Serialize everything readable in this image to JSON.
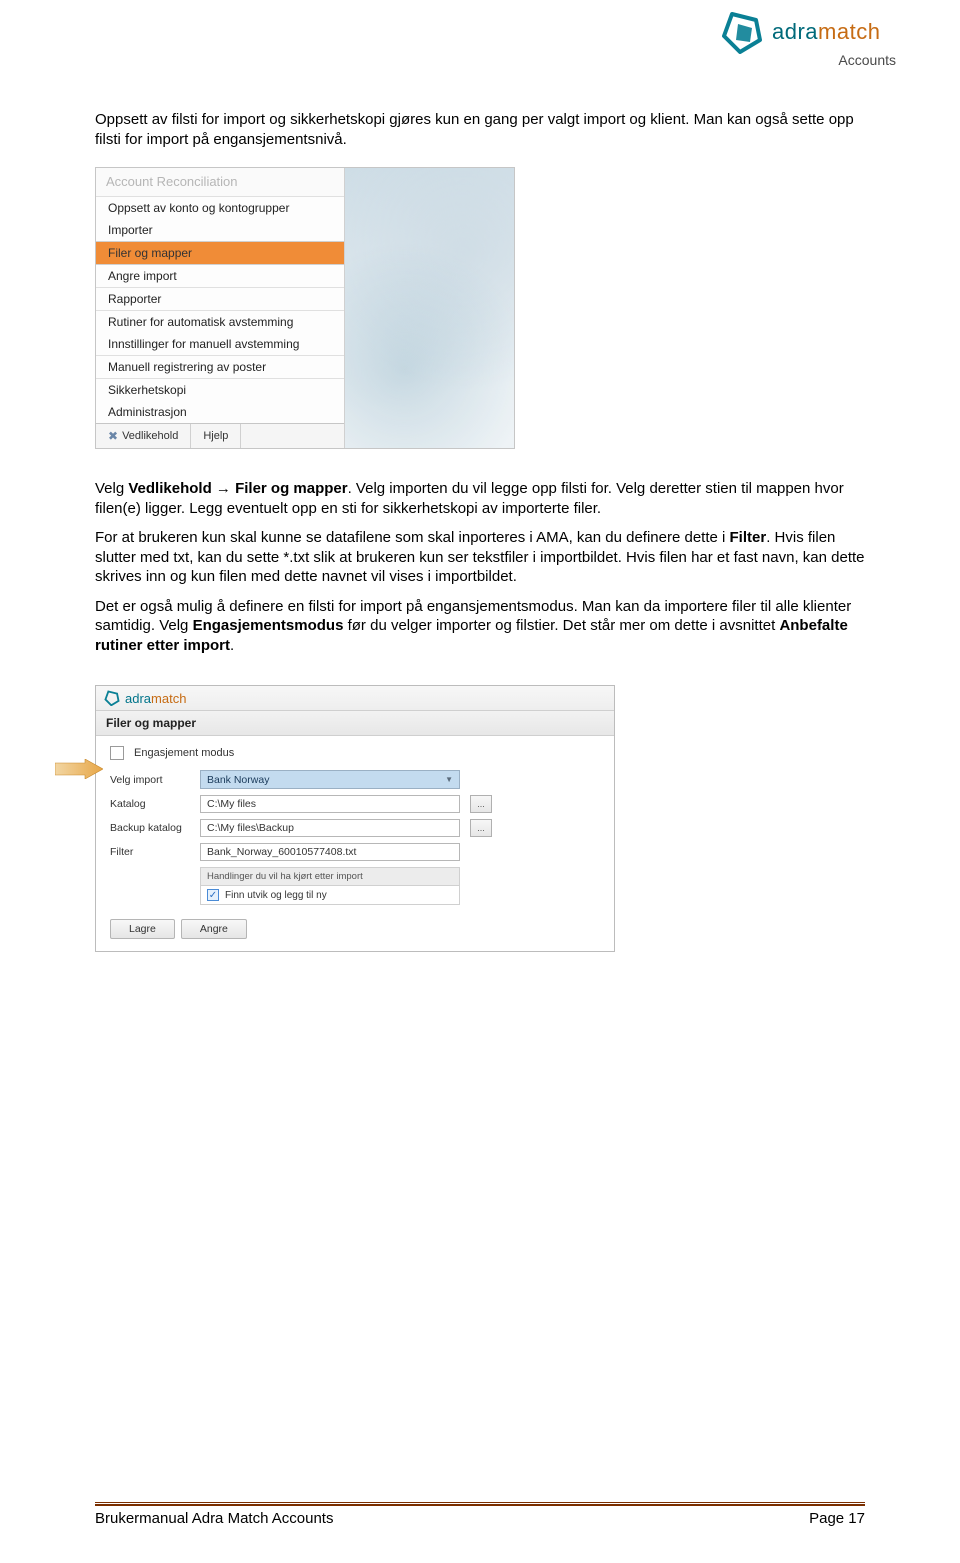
{
  "logo": {
    "brand": "adra",
    "brand2": "match",
    "sub": "Accounts"
  },
  "intro": {
    "p1a": "Oppsett av filsti for import og sikkerhetskopi gjøres kun en gang per valgt import og klient. ",
    "p1b": "Man kan også sette opp filsti for import på engansjementsnivå."
  },
  "sc1": {
    "header": "Account Reconciliation",
    "items": [
      "Oppsett av konto og kontogrupper",
      "Importer",
      "Filer og mapper",
      "Angre import",
      "Rapporter",
      "Rutiner for automatisk avstemming",
      "Innstillinger for manuell avstemming",
      "Manuell registrering av poster",
      "Sikkerhetskopi",
      "Administrasjon"
    ],
    "selected_index": 2,
    "bottom_left": "Vedlikehold",
    "bottom_right": "Hjelp"
  },
  "mid": {
    "p2_pre": "Velg ",
    "p2_bold": "Vedlikehold → Filer og mapper",
    "p2_post": ". Velg importen du vil legge opp filsti for. Velg deretter stien til mappen hvor filen(e) ligger. Legg eventuelt opp en sti for sikkerhetskopi av importerte filer.",
    "p3_a": "For at brukeren kun skal kunne se datafilene som skal inporteres i AMA, kan du definere dette i ",
    "p3_b": "Filter",
    "p3_c": ". Hvis filen slutter med txt, kan du sette *.txt slik at brukeren kun ser tekstfiler i importbildet. Hvis filen har et fast navn, kan dette skrives inn og kun filen med dette navnet vil vises i importbildet.",
    "p4_a": "Det er også mulig å definere en filsti for import på engansjementsmodus. Man kan da importere filer til alle klienter samtidig. Velg ",
    "p4_b": "Engasjementsmodus",
    "p4_c": " før du velger importer og filstier. Det står mer om dette i avsnittet ",
    "p4_d": "Anbefalte rutiner etter import",
    "p4_e": "."
  },
  "sc2": {
    "toolbar_brand": "adra",
    "toolbar_brand2": "match",
    "title": "Filer og mapper",
    "engagement_label": "Engasjement modus",
    "rows": {
      "import_label": "Velg import",
      "import_value": "Bank Norway",
      "katalog_label": "Katalog",
      "katalog_value": "C:\\My files",
      "backup_label": "Backup katalog",
      "backup_value": "C:\\My files\\Backup",
      "filter_label": "Filter",
      "filter_value": "Bank_Norway_60010577408.txt"
    },
    "handling_header": "Handlinger du vil ha kjørt etter import",
    "check_label": "Finn utvik og legg til ny",
    "btn_save": "Lagre",
    "btn_cancel": "Angre"
  },
  "footer": {
    "left": "Brukermanual Adra Match Accounts",
    "right": "Page 17"
  }
}
